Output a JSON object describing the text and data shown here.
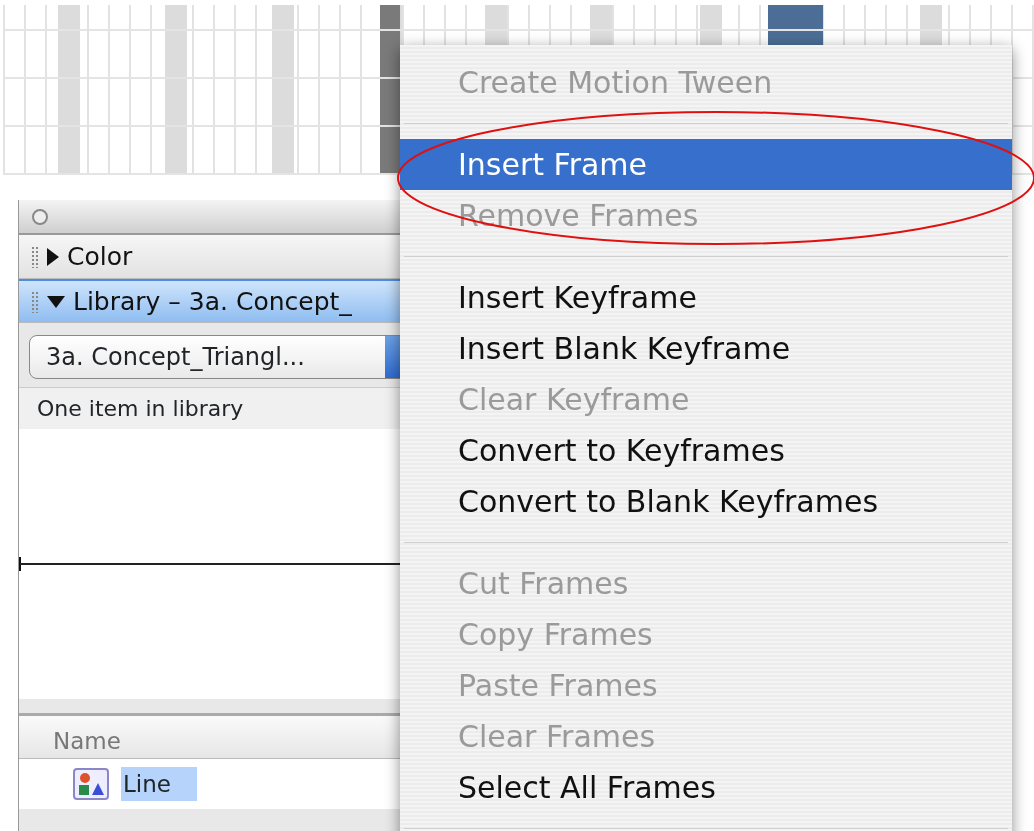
{
  "panel": {
    "sections": [
      {
        "label": "Color",
        "expanded": false
      },
      {
        "label": "Library – 3a. Concept_",
        "expanded": true
      }
    ],
    "library_select": {
      "value": "3a. Concept_Triangl..."
    },
    "item_count": "One item in library",
    "columns": [
      "Name"
    ],
    "items": [
      {
        "name": "Line",
        "selected": true
      }
    ]
  },
  "context_menu": {
    "items": [
      {
        "kind": "item",
        "label": "Create Motion Tween",
        "disabled": true,
        "selected": false
      },
      {
        "kind": "separator"
      },
      {
        "kind": "item",
        "label": "Insert Frame",
        "disabled": false,
        "selected": true
      },
      {
        "kind": "item",
        "label": "Remove Frames",
        "disabled": true,
        "selected": false
      },
      {
        "kind": "separator"
      },
      {
        "kind": "item",
        "label": "Insert Keyframe",
        "disabled": false,
        "selected": false
      },
      {
        "kind": "item",
        "label": "Insert Blank Keyframe",
        "disabled": false,
        "selected": false
      },
      {
        "kind": "item",
        "label": "Clear Keyframe",
        "disabled": true,
        "selected": false
      },
      {
        "kind": "item",
        "label": "Convert to Keyframes",
        "disabled": false,
        "selected": false
      },
      {
        "kind": "item",
        "label": "Convert to Blank Keyframes",
        "disabled": false,
        "selected": false
      },
      {
        "kind": "separator"
      },
      {
        "kind": "item",
        "label": "Cut Frames",
        "disabled": true,
        "selected": false
      },
      {
        "kind": "item",
        "label": "Copy Frames",
        "disabled": true,
        "selected": false
      },
      {
        "kind": "item",
        "label": "Paste Frames",
        "disabled": true,
        "selected": false
      },
      {
        "kind": "item",
        "label": "Clear Frames",
        "disabled": true,
        "selected": false
      },
      {
        "kind": "item",
        "label": "Select All Frames",
        "disabled": false,
        "selected": false
      },
      {
        "kind": "separator"
      }
    ]
  }
}
